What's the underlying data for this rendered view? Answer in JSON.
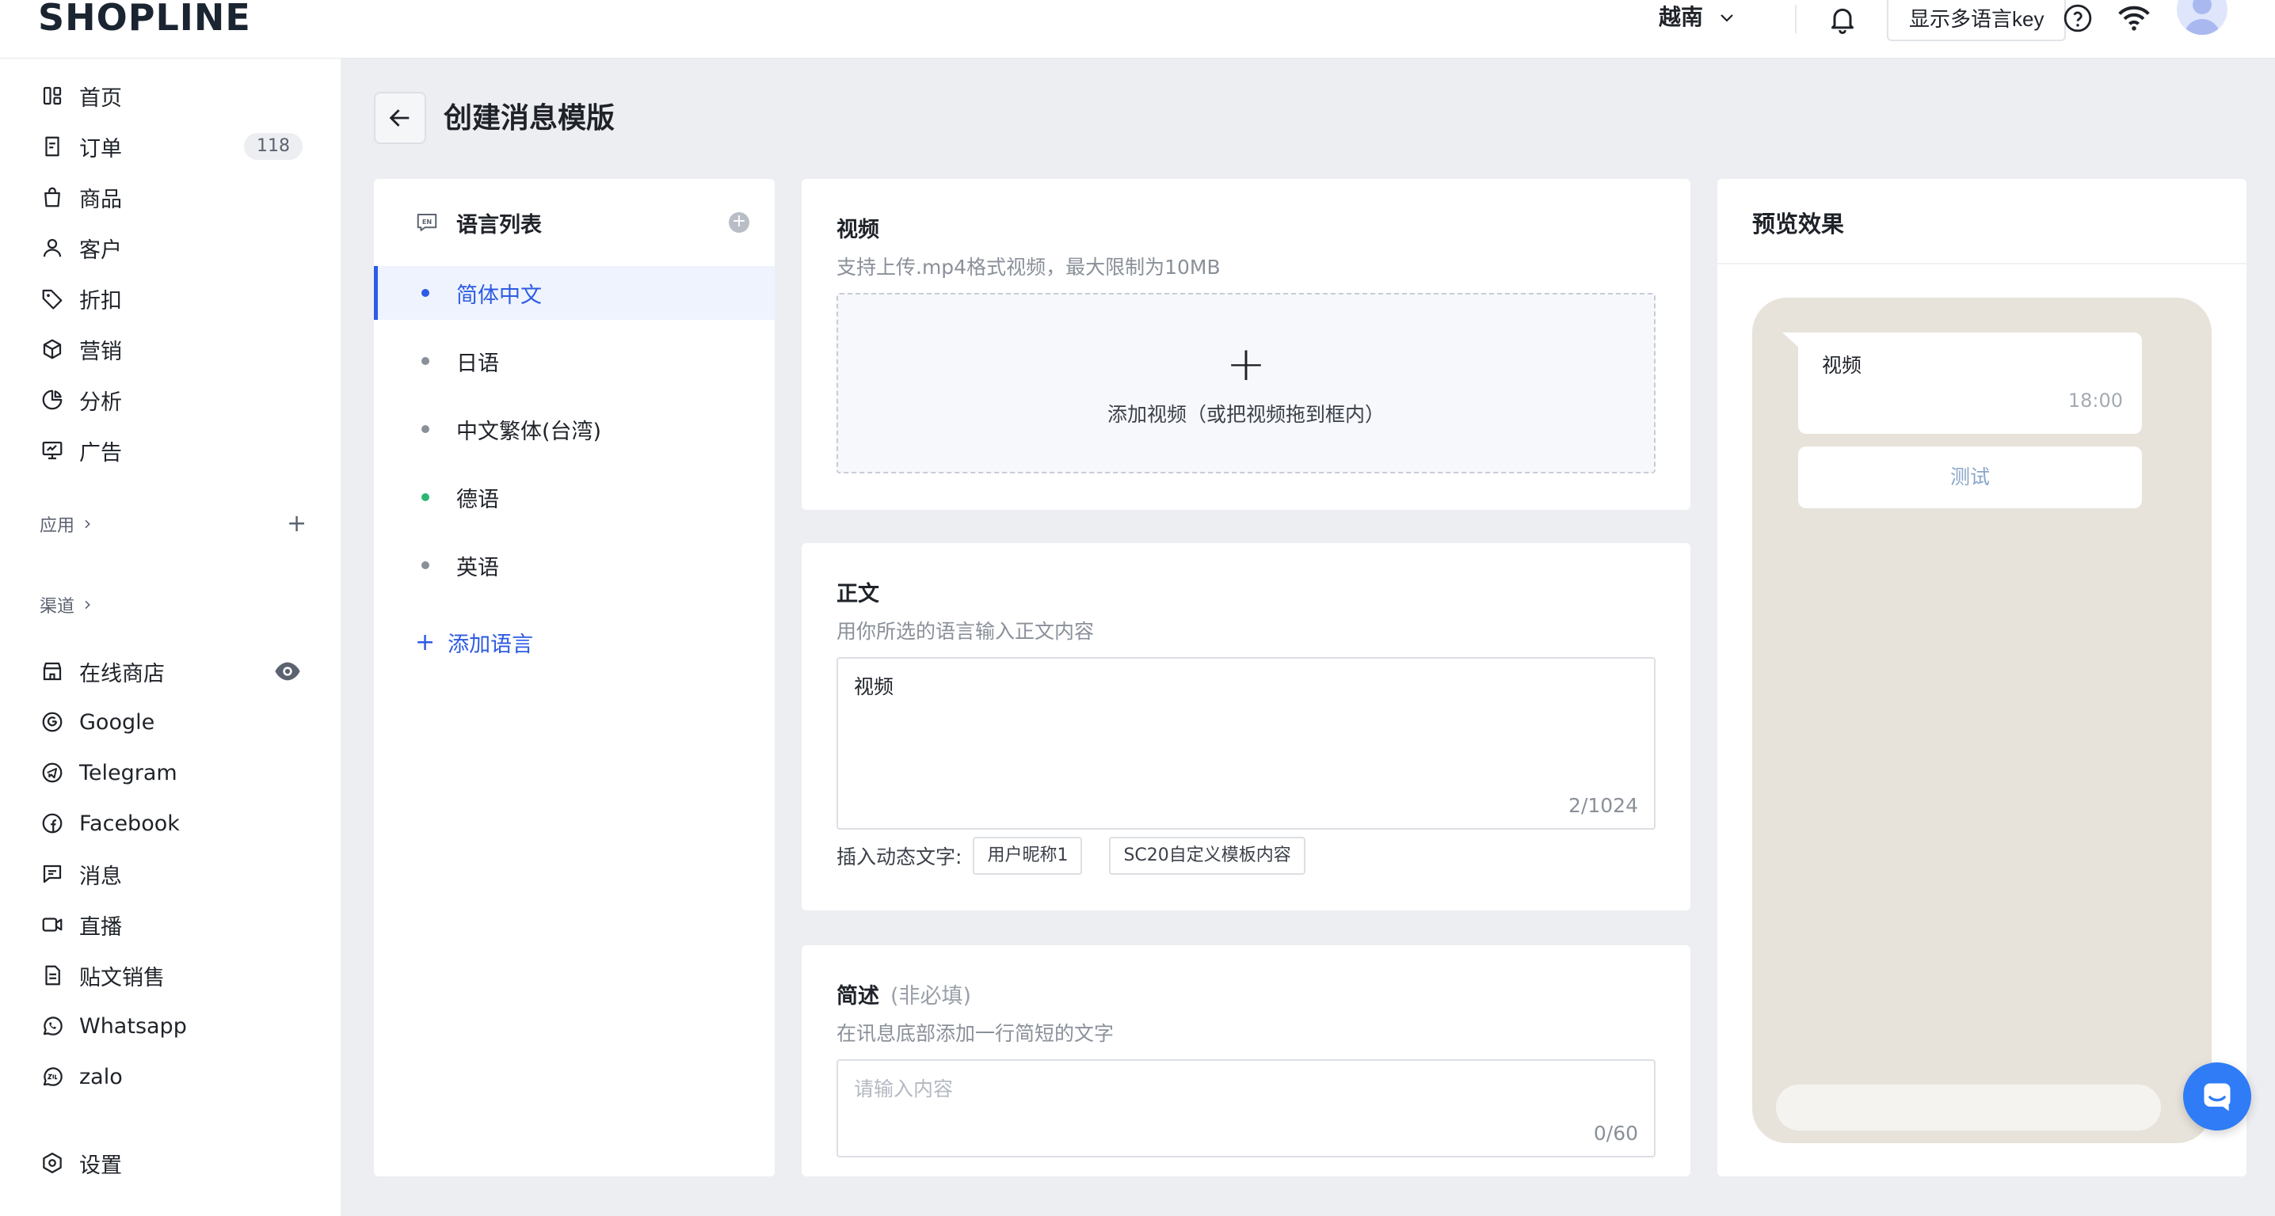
{
  "app": {
    "logo": "SHOPLINE"
  },
  "topbar": {
    "region": "越南",
    "show_lang_key_label": "显示多语言key"
  },
  "sidebar": {
    "items": [
      {
        "label": "首页",
        "icon": "dashboard-icon"
      },
      {
        "label": "订单",
        "icon": "order-icon",
        "badge": "118"
      },
      {
        "label": "商品",
        "icon": "bag-icon"
      },
      {
        "label": "客户",
        "icon": "user-icon"
      },
      {
        "label": "折扣",
        "icon": "tag-icon"
      },
      {
        "label": "营销",
        "icon": "cube-icon"
      },
      {
        "label": "分析",
        "icon": "pie-chart-icon"
      },
      {
        "label": "广告",
        "icon": "ad-icon"
      }
    ],
    "apps_section": {
      "label": "应用"
    },
    "channels_section": {
      "label": "渠道"
    },
    "channels": [
      {
        "label": "在线商店",
        "icon": "store-icon"
      },
      {
        "label": "Google",
        "icon": "google-icon"
      },
      {
        "label": "Telegram",
        "icon": "telegram-icon"
      },
      {
        "label": "Facebook",
        "icon": "facebook-icon"
      },
      {
        "label": "消息",
        "icon": "message-icon"
      },
      {
        "label": "直播",
        "icon": "video-camera-icon"
      },
      {
        "label": "贴文销售",
        "icon": "post-icon"
      },
      {
        "label": "Whatsapp",
        "icon": "whatsapp-icon"
      },
      {
        "label": "zalo",
        "icon": "zalo-icon"
      }
    ],
    "settings": {
      "label": "设置",
      "icon": "settings-icon"
    }
  },
  "page": {
    "title": "创建消息模版"
  },
  "languages": {
    "header": "语言列表",
    "items": [
      {
        "label": "简体中文",
        "active": true
      },
      {
        "label": "日语"
      },
      {
        "label": "中文繁体(台湾)"
      },
      {
        "label": "德语",
        "status_color": "#2bb673"
      },
      {
        "label": "英语"
      }
    ],
    "add_label": "添加语言"
  },
  "video_section": {
    "title": "视频",
    "description": "支持上传.mp4格式视频，最大限制为10MB",
    "upload_text": "添加视频（或把视频拖到框内）"
  },
  "body_section": {
    "title": "正文",
    "description": "用你所选的语言输入正文内容",
    "value": "视频",
    "counter": "2/1024",
    "insert_label": "插入动态文字:",
    "tags": [
      "用户昵称1",
      "SC20自定义模板内容"
    ]
  },
  "summary_section": {
    "title": "简述",
    "optional": "(非必填)",
    "description": "在讯息底部添加一行简短的文字",
    "placeholder": "请输入内容",
    "counter": "0/60"
  },
  "preview": {
    "title": "预览效果",
    "message_text": "视频",
    "time": "18:00",
    "button_label": "测试"
  },
  "colors": {
    "accent": "#2d5be3",
    "fab": "#2f7cf6",
    "phone_bg": "#e8e3da"
  }
}
